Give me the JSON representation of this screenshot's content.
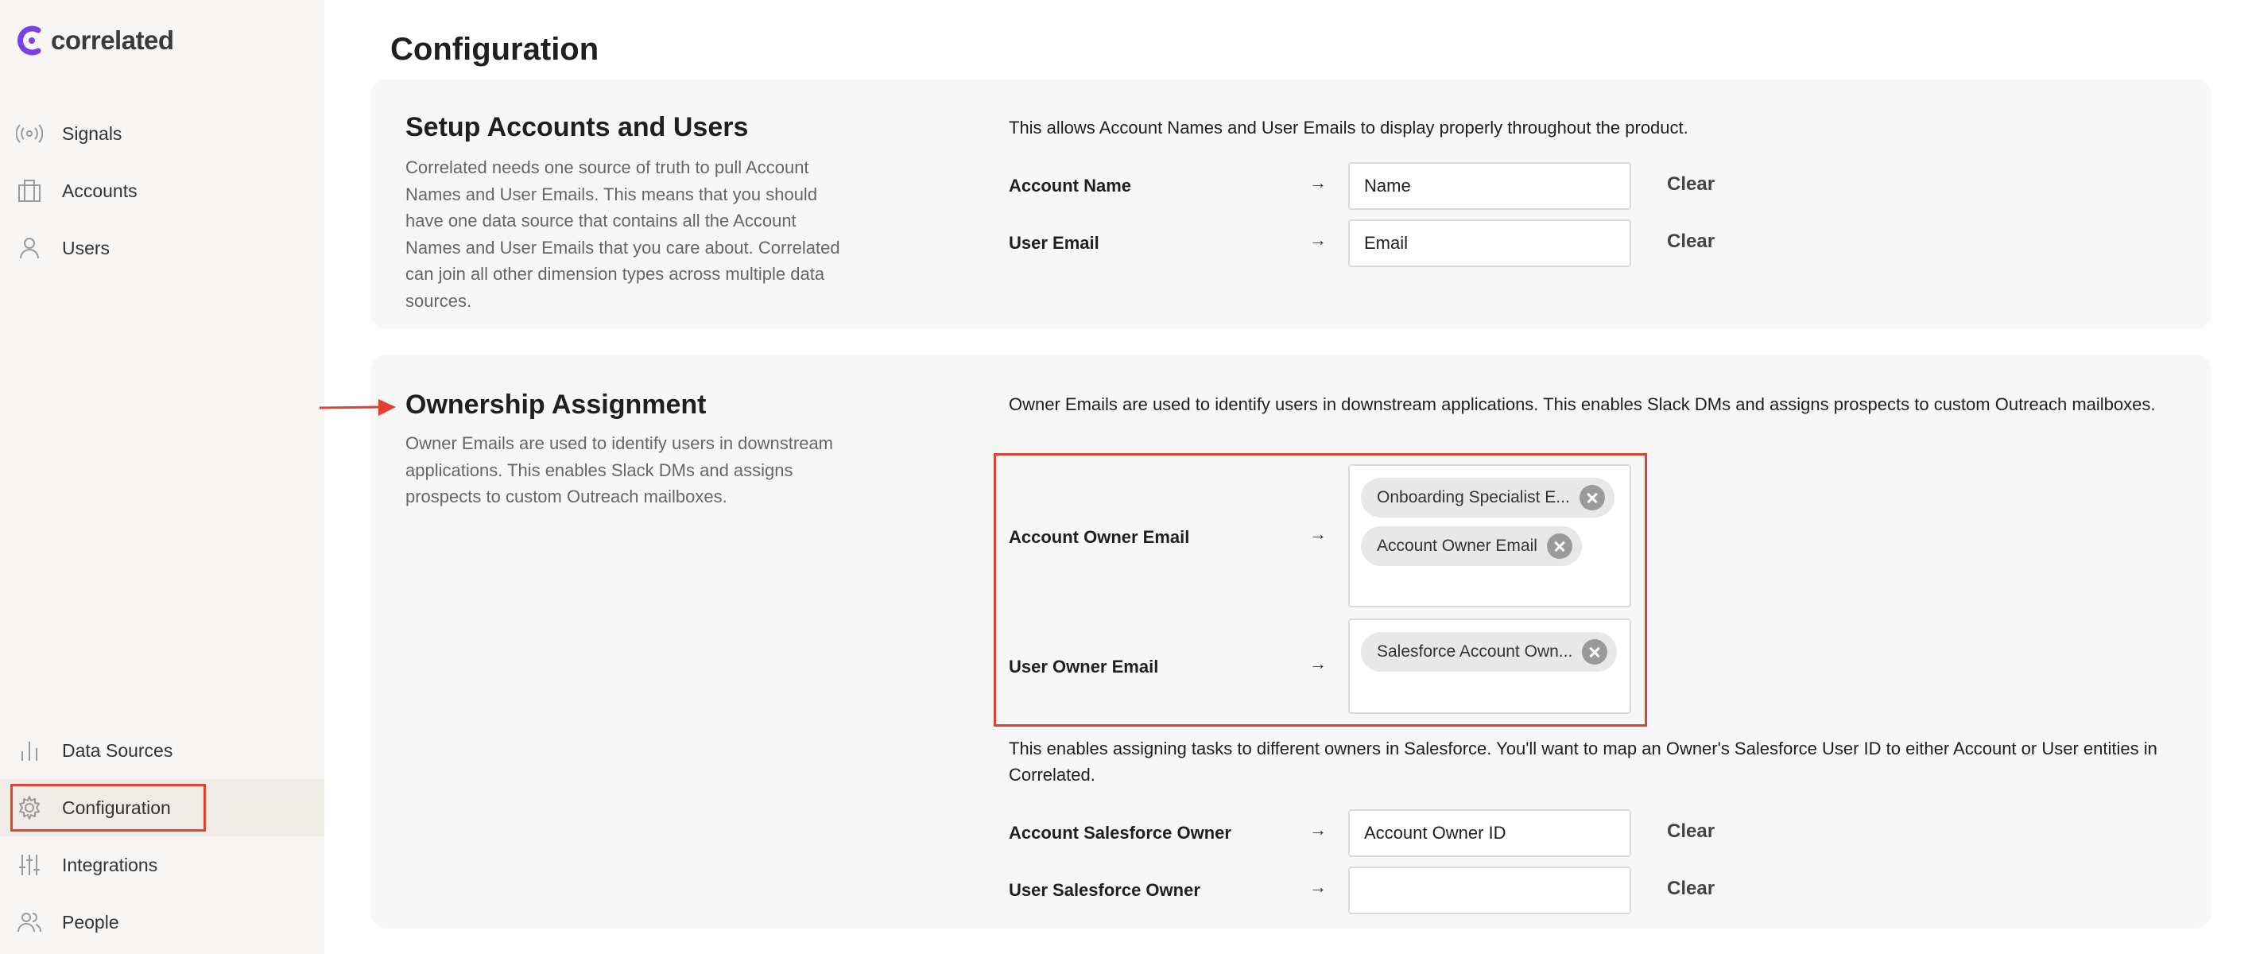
{
  "app": {
    "logo_text": "correlated"
  },
  "sidebar": {
    "items": [
      {
        "label": "Signals",
        "icon": "signal-icon"
      },
      {
        "label": "Accounts",
        "icon": "building-icon"
      },
      {
        "label": "Users",
        "icon": "user-icon"
      },
      {
        "label": "Data Sources",
        "icon": "bar-chart-icon"
      },
      {
        "label": "Configuration",
        "icon": "gear-icon",
        "active": true
      },
      {
        "label": "Integrations",
        "icon": "sliders-icon"
      },
      {
        "label": "People",
        "icon": "people-icon"
      }
    ]
  },
  "page": {
    "title": "Configuration"
  },
  "setup": {
    "title": "Setup Accounts and Users",
    "description": "Correlated needs one source of truth to pull Account Names and User Emails. This means that you should have one data source that contains all the Account Names and User Emails that you care about. Correlated can join all other dimension types across multiple data sources.",
    "intro": "This allows Account Names and User Emails to display properly throughout the product.",
    "rows": [
      {
        "label": "Account Name",
        "value": "Name",
        "clear": "Clear"
      },
      {
        "label": "User Email",
        "value": "Email",
        "clear": "Clear"
      }
    ]
  },
  "ownership": {
    "title": "Ownership Assignment",
    "description": "Owner Emails are used to identify users in downstream applications. This enables Slack DMs and assigns prospects to custom Outreach mailboxes.",
    "intro": "Owner Emails are used to identify users in downstream applications. This enables Slack DMs and assigns prospects to custom Outreach mailboxes.",
    "account_owner_email": {
      "label": "Account Owner Email",
      "chips": [
        "Onboarding Specialist E...",
        "Account Owner Email"
      ]
    },
    "user_owner_email": {
      "label": "User Owner Email",
      "chips": [
        "Salesforce Account Own..."
      ]
    },
    "salesforce_intro": "This enables assigning tasks to different owners in Salesforce. You'll want to map an Owner's Salesforce User ID to either Account or User entities in Correlated.",
    "salesforce_rows": [
      {
        "label": "Account Salesforce Owner",
        "value": "Account Owner ID",
        "clear": "Clear"
      },
      {
        "label": "User Salesforce Owner",
        "value": "",
        "clear": "Clear"
      }
    ]
  },
  "arrow_glyph": "→",
  "colors": {
    "accent_purple": "#7b3fe4",
    "highlight_red": "#e1412f",
    "sidebar_bg": "#f7f6f5",
    "card_bg": "#f7f7f7"
  }
}
